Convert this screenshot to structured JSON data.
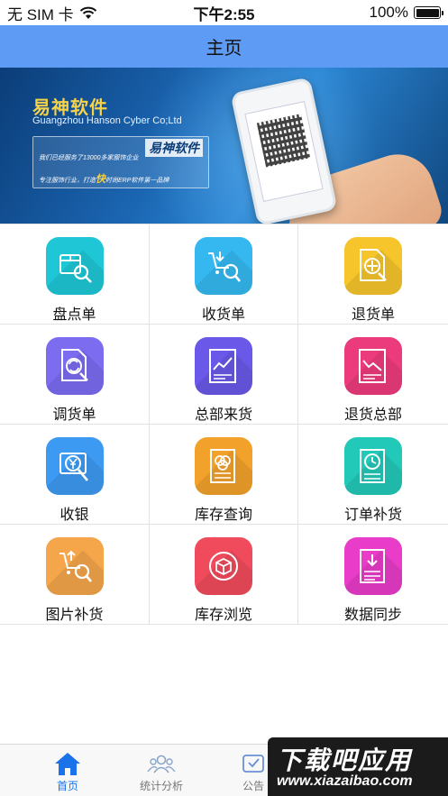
{
  "status_bar": {
    "carrier": "无 SIM 卡",
    "time": "下午2:55",
    "battery_percent": "100%",
    "battery_level": 1.0
  },
  "nav": {
    "title": "主页"
  },
  "banner": {
    "brand": "易神软件",
    "company": "Guangzhou Hanson Cyber Co;Ltd",
    "card_logo": "易神软件",
    "card_line1": "我们已经服务了13000多家服饰企业",
    "card_line2_pre": "专注服饰行业，打造",
    "card_line2_em": "快",
    "card_line2_post": "时尚ERP软件第一品牌"
  },
  "grid": {
    "items": [
      {
        "label": "盘点单",
        "color": "#1fc7d6",
        "icon": "box-search-icon"
      },
      {
        "label": "收货单",
        "color": "#35b8f0",
        "icon": "cart-search-icon"
      },
      {
        "label": "退货单",
        "color": "#f5c52b",
        "icon": "move-doc-icon"
      },
      {
        "label": "调货单",
        "color": "#7b6cf0",
        "icon": "exchange-doc-icon"
      },
      {
        "label": "总部来货",
        "color": "#6a58e8",
        "icon": "chart-doc-icon"
      },
      {
        "label": "退货总部",
        "color": "#ec3b7c",
        "icon": "chart-doc-down-icon"
      },
      {
        "label": "收银",
        "color": "#3d9af2",
        "icon": "yuan-search-icon"
      },
      {
        "label": "库存查询",
        "color": "#f2a12b",
        "icon": "stock-doc-icon"
      },
      {
        "label": "订单补货",
        "color": "#23c9b8",
        "icon": "clock-doc-icon"
      },
      {
        "label": "图片补货",
        "color": "#f5a54a",
        "icon": "cart-upload-icon"
      },
      {
        "label": "库存浏览",
        "color": "#f04b5c",
        "icon": "box-browse-icon"
      },
      {
        "label": "数据同步",
        "color": "#e93cc8",
        "icon": "sync-doc-icon"
      }
    ]
  },
  "tab_bar": {
    "tabs": [
      {
        "label": "首页",
        "active": true
      },
      {
        "label": "统计分析",
        "active": false
      },
      {
        "label": "公告",
        "active": false
      }
    ]
  },
  "watermark": {
    "title": "下载吧应用",
    "url": "www.xiazaibao.com"
  },
  "colors": {
    "nav": "#5e9bf5",
    "tab_active": "#1a73e8"
  }
}
